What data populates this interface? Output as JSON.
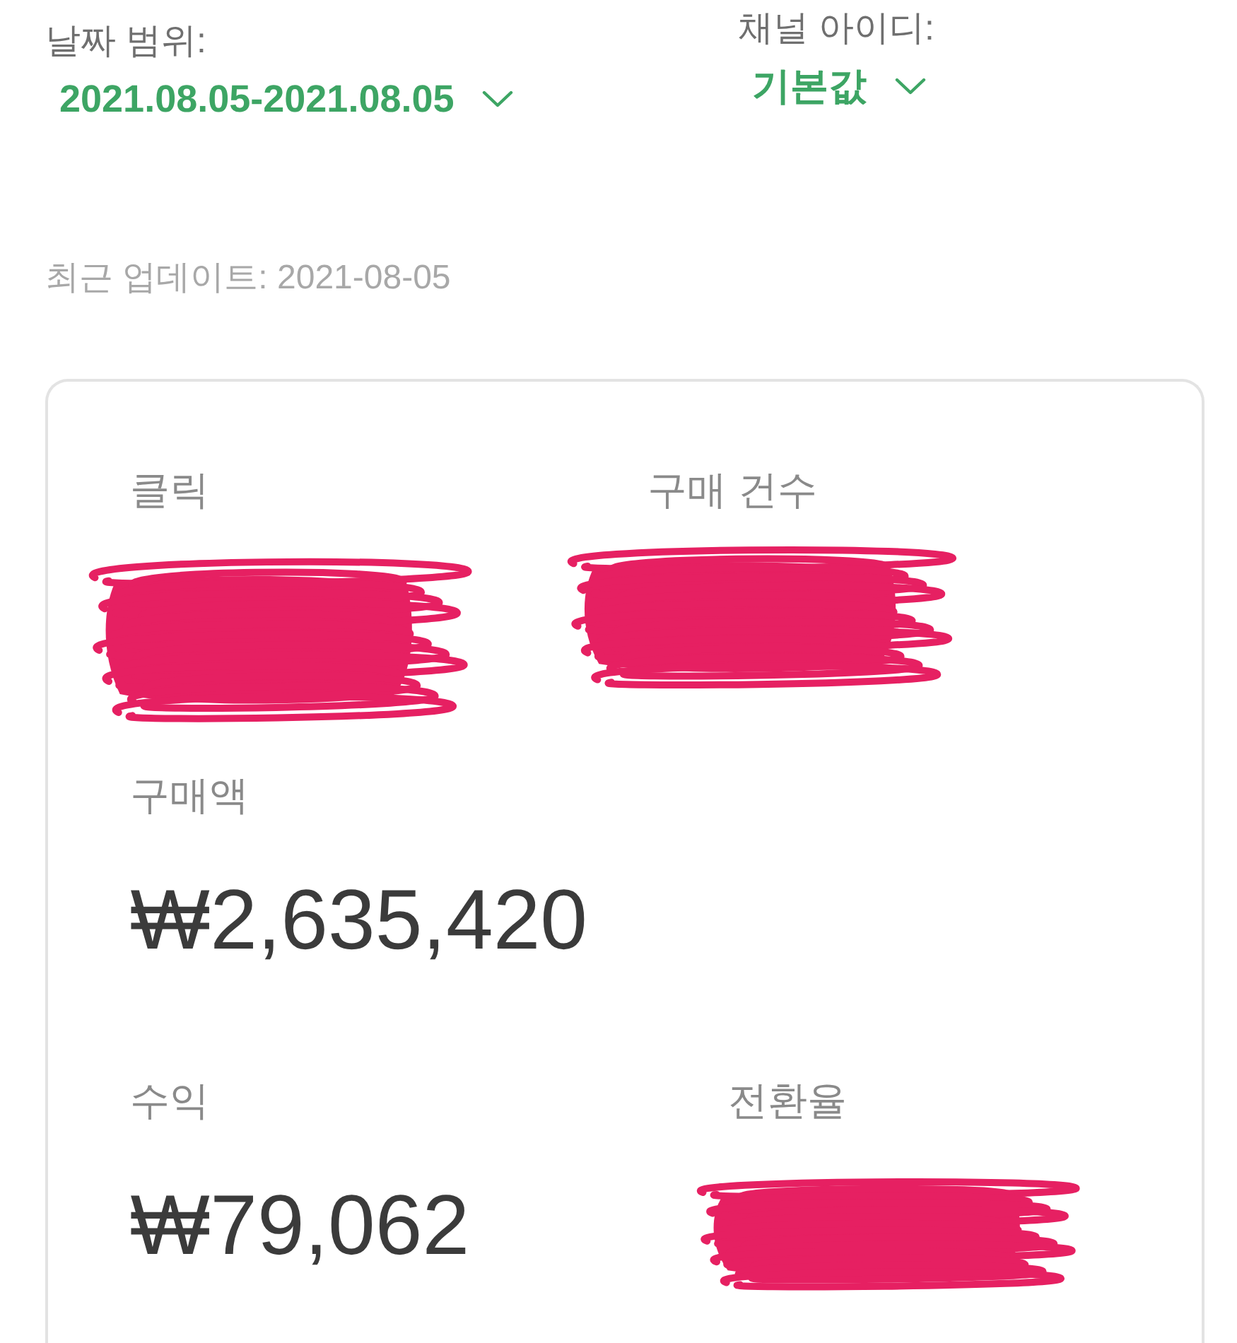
{
  "filters": [
    {
      "label": "날짜 범위:",
      "value": "2021.08.05-2021.08.05"
    },
    {
      "label": "채널 아이디:",
      "value": "기본값"
    }
  ],
  "last_updated": "최근 업데이트: 2021-08-05",
  "metric_rows": [
    {
      "items": [
        {
          "label": "클릭",
          "redacted": true
        },
        {
          "label": "구매 건수",
          "redacted": true
        }
      ]
    },
    {
      "items": [
        {
          "label": "구매액",
          "value": "₩2,635,420",
          "redacted": false
        }
      ]
    },
    {
      "items": [
        {
          "label": "수익",
          "value": "₩79,062",
          "redacted": false
        },
        {
          "label": "전환율",
          "redacted": true
        }
      ]
    }
  ]
}
